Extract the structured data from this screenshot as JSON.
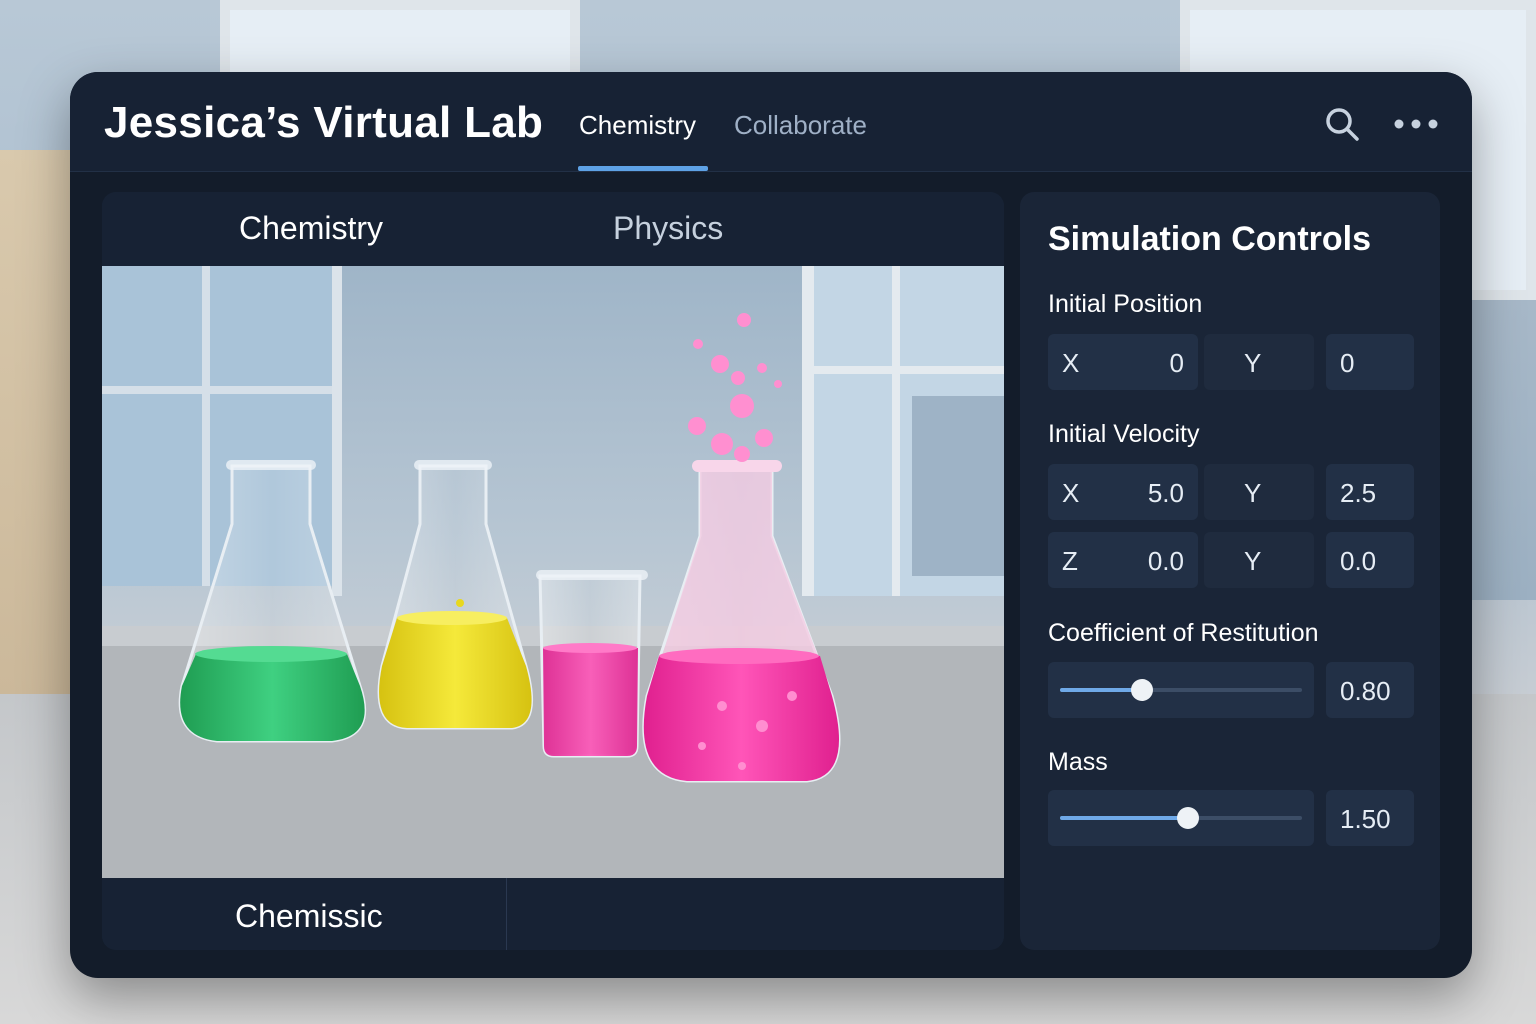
{
  "app": {
    "title": "Jessica’s Virtual Lab",
    "nav_tabs": [
      {
        "label": "Chemistry",
        "active": true
      },
      {
        "label": "Collaborate",
        "active": false
      }
    ],
    "icons": {
      "search": "search-icon",
      "more": "more-horizontal-icon"
    },
    "accent_color": "#5ea2e6"
  },
  "lab": {
    "tabs": [
      {
        "label": "Chemistry",
        "active": true
      },
      {
        "label": "Physics",
        "active": false
      }
    ],
    "footer_label": "Chemissic",
    "liquid_colors": {
      "green": "#2fbf6a",
      "yellow": "#e8d81e",
      "pink": "#ef3aa3"
    }
  },
  "controls": {
    "title": "Simulation Controls",
    "initial_position": {
      "label": "Initial Position",
      "x_axis": "X",
      "x_value": "0",
      "y_axis": "Y",
      "y_value": "0"
    },
    "initial_velocity": {
      "label": "Initial Velocity",
      "row1": {
        "axis_a": "X",
        "value_a": "5.0",
        "axis_b": "Y",
        "value_b": "2.5"
      },
      "row2": {
        "axis_a": "Z",
        "value_a": "0.0",
        "axis_b": "Y",
        "value_b": "0.0"
      }
    },
    "restitution": {
      "label": "Coefficient of Restitution",
      "value": "0.80",
      "fraction": 0.34
    },
    "mass": {
      "label": "Mass",
      "value": "1.50",
      "fraction": 0.53
    }
  }
}
